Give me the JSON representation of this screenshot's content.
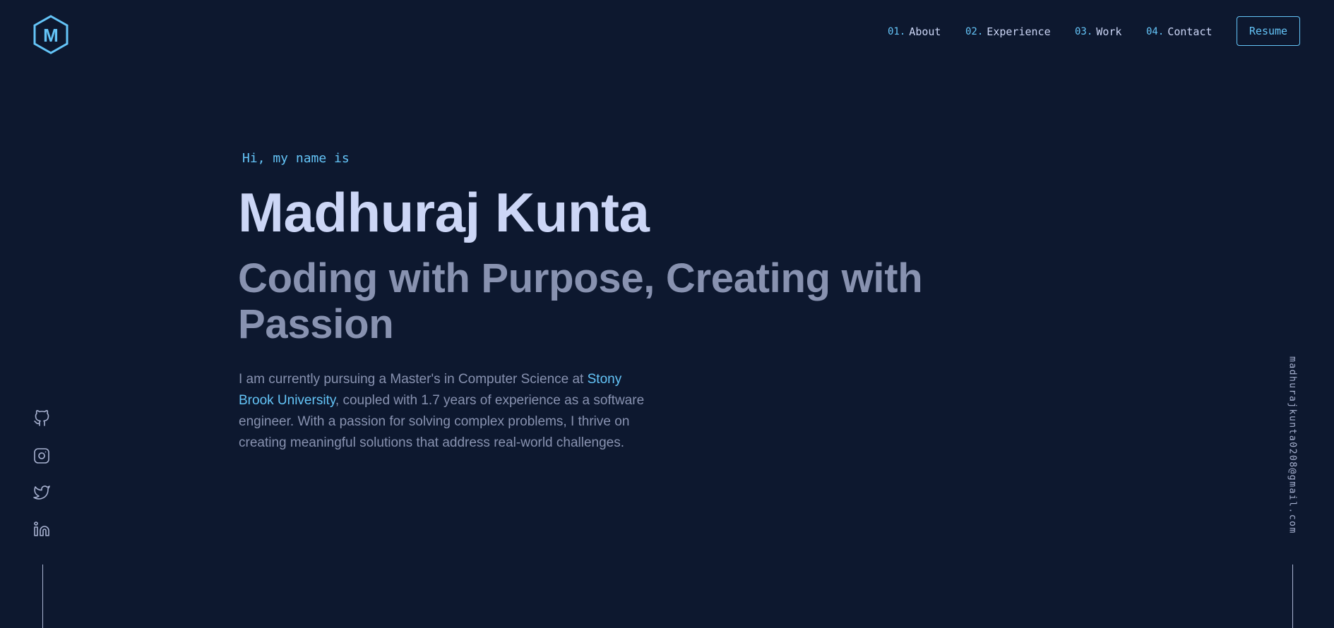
{
  "header": {
    "logo_letter": "M",
    "nav": [
      {
        "number": "01.",
        "label": "About"
      },
      {
        "number": "02.",
        "label": "Experience"
      },
      {
        "number": "03.",
        "label": "Work"
      },
      {
        "number": "04.",
        "label": "Contact"
      }
    ],
    "resume_label": "Resume"
  },
  "hero": {
    "greeting": "Hi, my name is",
    "name": "Madhuraj Kunta",
    "tagline": "Coding with Purpose, Creating with Passion",
    "description_start": "I am currently pursuing a Master's in Computer Science at ",
    "university_link": "Stony Brook University",
    "description_end": ", coupled with 1.7 years of experience as a software engineer. With a passion for solving complex problems, I thrive on creating meaningful solutions that address real-world challenges."
  },
  "social": {
    "icons": [
      "github-icon",
      "instagram-icon",
      "twitter-icon",
      "linkedin-icon"
    ]
  },
  "email": "madhurajkunta0208@gmail.com",
  "colors": {
    "background": "#0d182f",
    "accent": "#64c4f7",
    "heading": "#ccd6f6",
    "text": "#8892b0"
  }
}
